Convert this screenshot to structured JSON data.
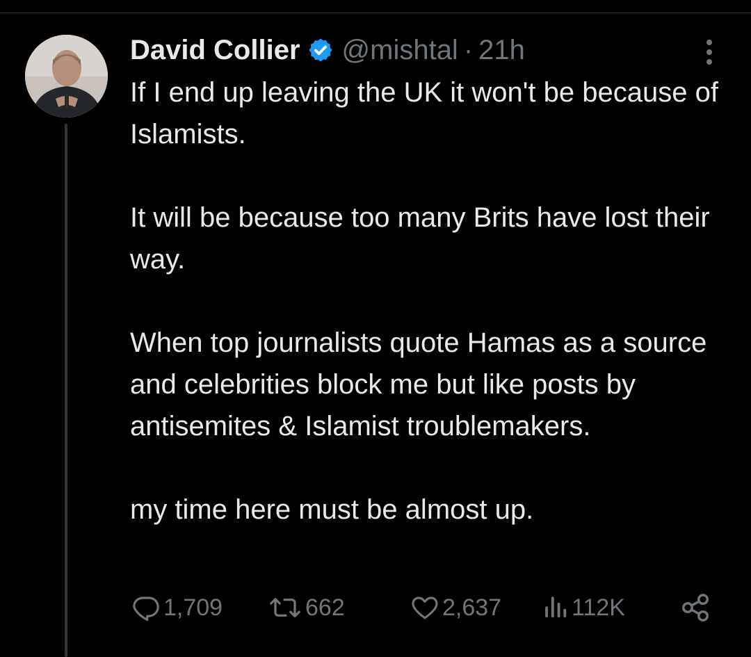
{
  "tweet": {
    "author": {
      "display_name": "David Collier",
      "handle": "@mishtal",
      "verified": true
    },
    "separator": "·",
    "time": "21h",
    "paragraphs": [
      "If I end up leaving the UK it won't be because of Islamists.",
      "It will be because too many Brits have lost their way.",
      "When top journalists quote Hamas as a source and celebrities block me but like posts by antisemites & Islamist troublemakers.",
      "my time here must be almost up."
    ],
    "stats": {
      "replies": "1,709",
      "retweets": "662",
      "likes": "2,637",
      "views": "112K"
    }
  },
  "icons": {
    "verified": "verified-badge-icon",
    "more": "more-vertical-icon",
    "reply": "reply-icon",
    "retweet": "retweet-icon",
    "like": "heart-icon",
    "views": "views-icon",
    "share": "share-icon"
  },
  "colors": {
    "background": "#000000",
    "text": "#e7e9ea",
    "muted": "#71767b",
    "verified": "#1d9bf0",
    "thread_line": "#333639"
  }
}
